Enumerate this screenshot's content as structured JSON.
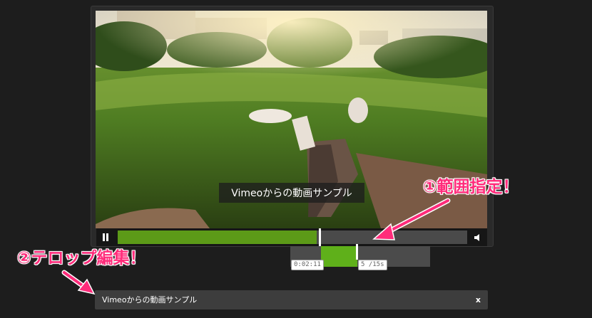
{
  "player": {
    "caption": "Vimeoからの動画サンプル",
    "progress_fraction": 0.57
  },
  "range": {
    "start_time": "0:02:11",
    "duration_label": "5 /15s",
    "selection_fraction": [
      0.22,
      0.48
    ]
  },
  "subtitle_editor": {
    "text": "Vimeoからの動画サンプル",
    "delete_label": "x"
  },
  "annotations": {
    "range_label": "①範囲指定！",
    "caption_label": "②テロップ編集！"
  },
  "colors": {
    "accent_green": "#5c9a18",
    "annotation_pink": "#ff2b7a"
  },
  "icons": [
    "pause-icon",
    "volume-icon",
    "arrow-icon"
  ]
}
